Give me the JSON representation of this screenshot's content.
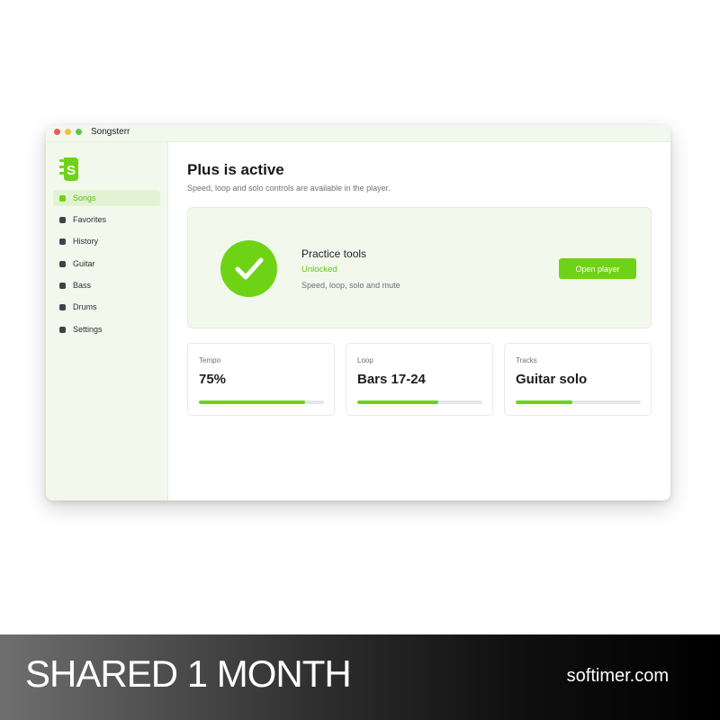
{
  "window": {
    "title": "Songsterr"
  },
  "sidebar": {
    "logo_icon": "songsterr-guitar-headstock-logo",
    "items": [
      {
        "label": "Songs",
        "active": true
      },
      {
        "label": "Favorites",
        "active": false
      },
      {
        "label": "History",
        "active": false
      },
      {
        "label": "Guitar",
        "active": false
      },
      {
        "label": "Bass",
        "active": false
      },
      {
        "label": "Drums",
        "active": false
      },
      {
        "label": "Settings",
        "active": false
      }
    ]
  },
  "main": {
    "title": "Plus is active",
    "subtitle": "Speed, loop and solo controls are available in the player.",
    "practice": {
      "icon": "check-circle-icon",
      "title": "Practice tools",
      "status": "Unlocked",
      "description": "Speed, loop, solo and mute",
      "button_label": "Open player"
    },
    "stats": [
      {
        "label": "Tempo",
        "value": "75%",
        "progress": 0.85
      },
      {
        "label": "Loop",
        "value": "Bars 17-24",
        "progress": 0.65
      },
      {
        "label": "Tracks",
        "value": "Guitar solo",
        "progress": 0.45
      }
    ]
  },
  "banner": {
    "title": "SHARED 1 MONTH",
    "site": "softimer.com"
  },
  "colors": {
    "accent": "#6fd315",
    "sidebar_bg": "#f2f9ec",
    "banner_dark": "#000000"
  }
}
